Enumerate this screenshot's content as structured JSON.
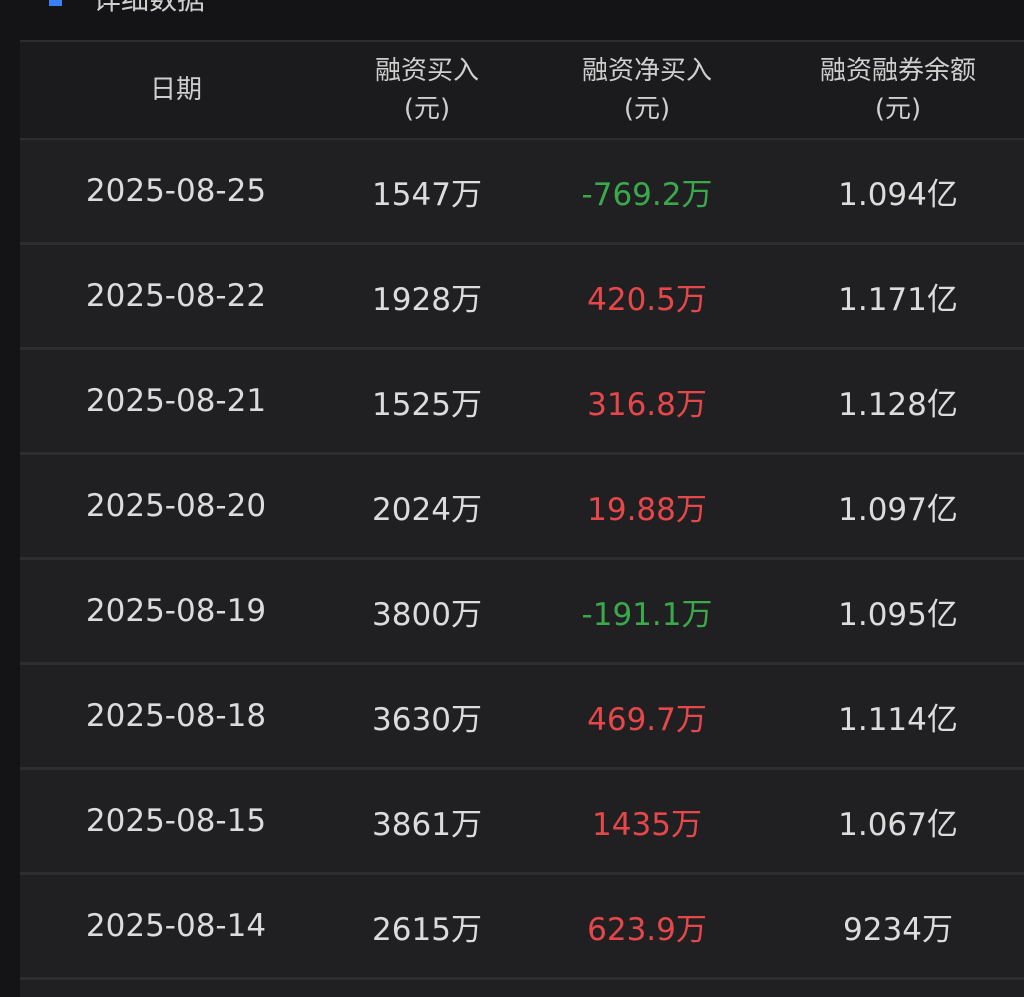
{
  "section": {
    "title": "详细数据",
    "accent_color": "#3a7ff6"
  },
  "table": {
    "headers": [
      {
        "line1": "日期",
        "line2": ""
      },
      {
        "line1": "融资买入",
        "line2": "(元)"
      },
      {
        "line1": "融资净买入",
        "line2": "(元)"
      },
      {
        "line1": "融资融券余额",
        "line2": "(元)"
      }
    ],
    "rows": [
      {
        "date": "2025-08-25",
        "buy": "1547万",
        "net": "-769.2万",
        "net_sign": "neg",
        "balance": "1.094亿"
      },
      {
        "date": "2025-08-22",
        "buy": "1928万",
        "net": "420.5万",
        "net_sign": "pos",
        "balance": "1.171亿"
      },
      {
        "date": "2025-08-21",
        "buy": "1525万",
        "net": "316.8万",
        "net_sign": "pos",
        "balance": "1.128亿"
      },
      {
        "date": "2025-08-20",
        "buy": "2024万",
        "net": "19.88万",
        "net_sign": "pos",
        "balance": "1.097亿"
      },
      {
        "date": "2025-08-19",
        "buy": "3800万",
        "net": "-191.1万",
        "net_sign": "neg",
        "balance": "1.095亿"
      },
      {
        "date": "2025-08-18",
        "buy": "3630万",
        "net": "469.7万",
        "net_sign": "pos",
        "balance": "1.114亿"
      },
      {
        "date": "2025-08-15",
        "buy": "3861万",
        "net": "1435万",
        "net_sign": "pos",
        "balance": "1.067亿"
      },
      {
        "date": "2025-08-14",
        "buy": "2615万",
        "net": "623.9万",
        "net_sign": "pos",
        "balance": "9234万"
      }
    ]
  },
  "colors": {
    "negative": "#3aa84b",
    "positive": "#e6474a"
  }
}
